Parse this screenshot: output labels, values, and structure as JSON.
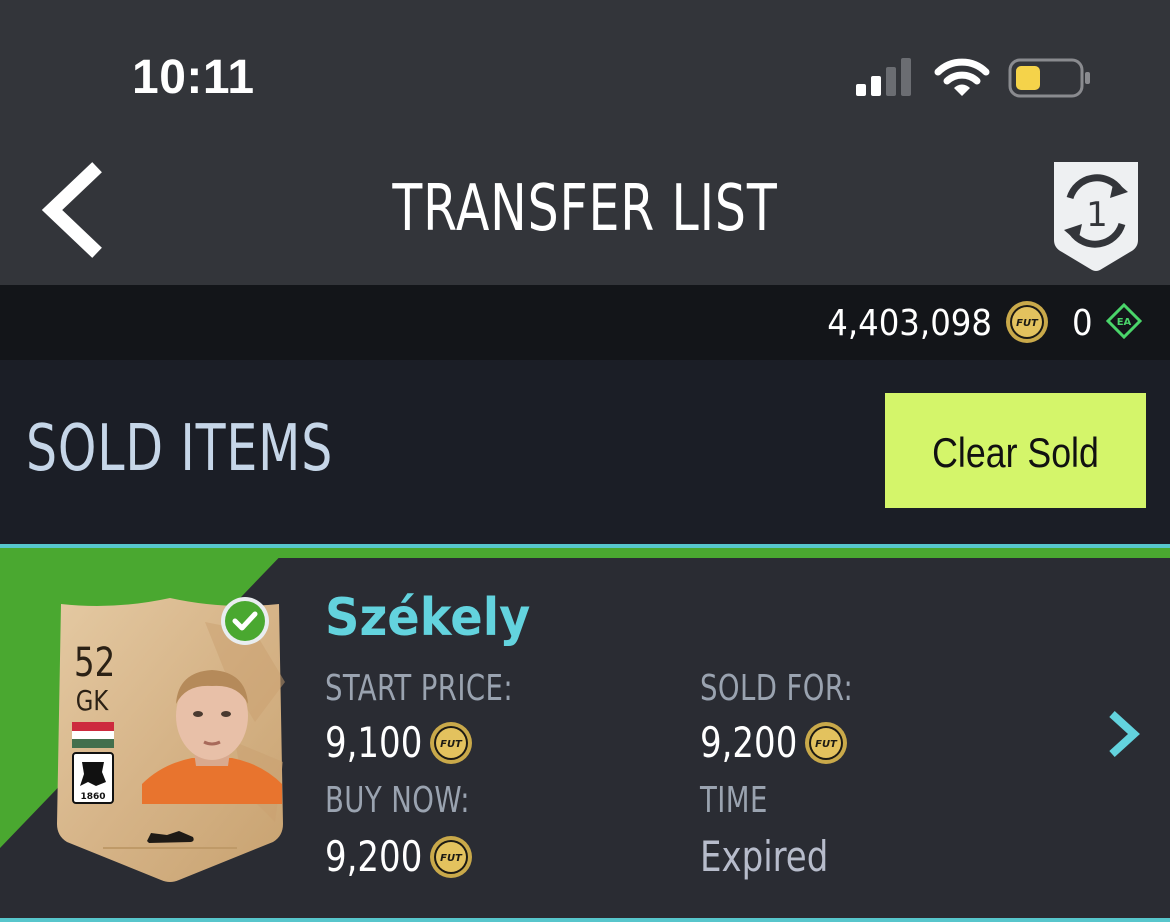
{
  "status_bar": {
    "time": "10:11"
  },
  "header": {
    "title": "TRANSFER LIST",
    "objectives_count": "1"
  },
  "currency": {
    "coins": "4,403,098",
    "points": "0",
    "coin_label": "FUT",
    "ea_label": "EA"
  },
  "section": {
    "title": "SOLD ITEMS",
    "clear_button_label": "Clear Sold"
  },
  "item": {
    "player_name": "Székely",
    "rating": "52",
    "position": "GK",
    "club_year": "1860",
    "start_price_label": "START PRICE:",
    "start_price": "9,100",
    "buy_now_label": "BUY NOW:",
    "buy_now": "9,200",
    "sold_for_label": "SOLD FOR:",
    "sold_for": "9,200",
    "time_label": "TIME",
    "time_value": "Expired"
  },
  "colors": {
    "accent_lime": "#d4f56a",
    "name_cyan": "#63d3de",
    "sold_green": "#4aa830",
    "battery_yellow": "#f5d34a"
  }
}
